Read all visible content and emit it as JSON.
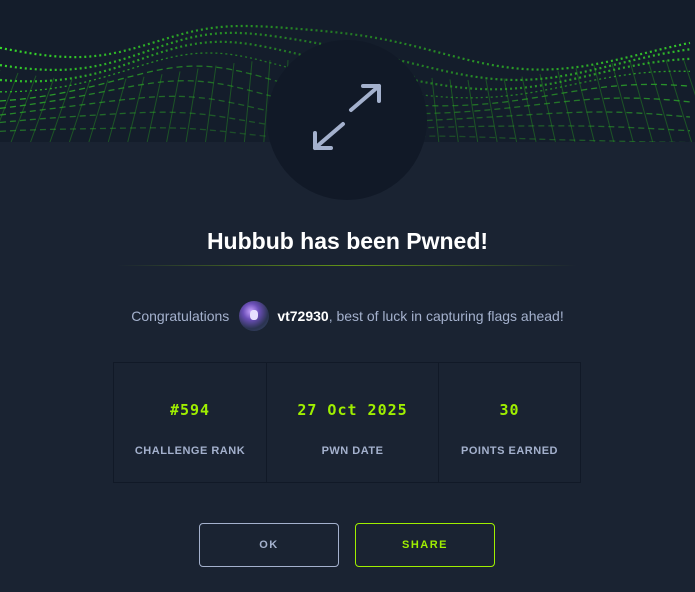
{
  "header": {
    "badge_icon": "expand-arrows-icon",
    "accent_color": "#9fef00"
  },
  "title": "Hubbub has been Pwned!",
  "congrats": {
    "prefix": "Congratulations",
    "username": "vt72930",
    "suffix": ", best of luck in capturing flags ahead!"
  },
  "stats": [
    {
      "value": "#594",
      "label": "CHALLENGE RANK"
    },
    {
      "value": "27 Oct 2025",
      "label": "PWN DATE"
    },
    {
      "value": "30",
      "label": "POINTS EARNED"
    }
  ],
  "buttons": {
    "ok_label": "OK",
    "share_label": "SHARE"
  }
}
